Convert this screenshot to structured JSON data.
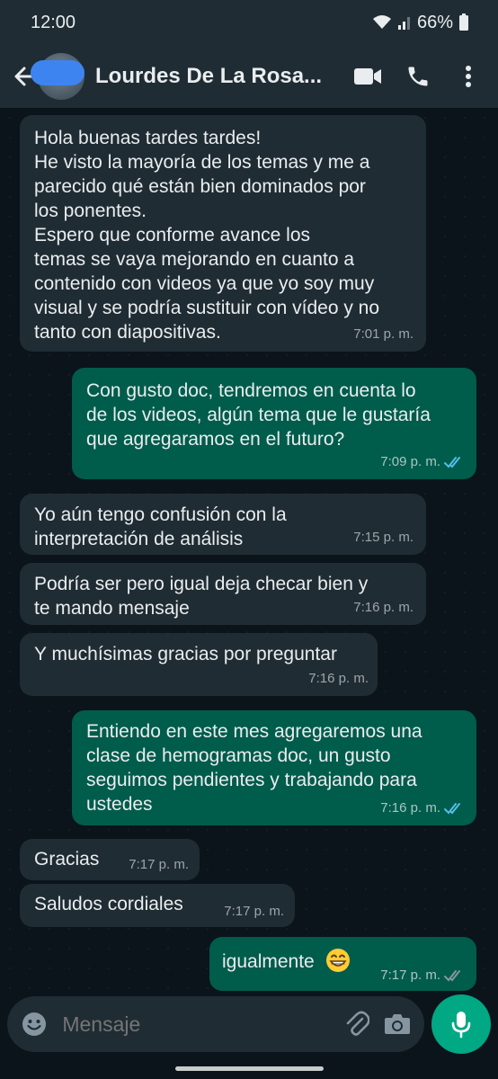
{
  "status_bar": {
    "time": "12:00",
    "battery": "66%"
  },
  "header": {
    "contact_name": "Lourdes De La Rosa..."
  },
  "messages": [
    {
      "direction": "in",
      "lines": [
        "Hola buenas tardes tardes!",
        "He visto la mayoría de los temas y me a",
        "parecido qué están bien dominados por",
        "los ponentes.",
        "Espero que conforme avance los",
        "temas se vaya mejorando en cuanto a",
        "contenido con videos ya que yo soy muy",
        "visual y se podría sustituir con vídeo y no",
        "tanto con diapositivas."
      ],
      "time": "7:01 p. m."
    },
    {
      "direction": "out",
      "lines": [
        "Con gusto doc, tendremos en cuenta lo",
        "de los videos, algún tema que le gustaría",
        "que agregaramos en el futuro?"
      ],
      "time": "7:09 p. m.",
      "read": true
    },
    {
      "direction": "in",
      "lines": [
        "Yo aún tengo confusión con la",
        "interpretación de análisis"
      ],
      "time": "7:15 p. m."
    },
    {
      "direction": "in",
      "lines": [
        "Podría ser pero igual deja checar bien y",
        "te mando mensaje"
      ],
      "time": "7:16 p. m."
    },
    {
      "direction": "in",
      "lines": [
        "Y muchísimas gracias por preguntar"
      ],
      "time": "7:16 p. m."
    },
    {
      "direction": "out",
      "lines": [
        "Entiendo en este mes agregaremos una",
        "clase de hemogramas doc, un gusto",
        "seguimos pendientes y trabajando para",
        "ustedes"
      ],
      "time": "7:16 p. m.",
      "read": true
    },
    {
      "direction": "in",
      "lines": [
        "Gracias"
      ],
      "time": "7:17 p. m."
    },
    {
      "direction": "in",
      "lines": [
        "Saludos cordiales"
      ],
      "time": "7:17 p. m."
    },
    {
      "direction": "out",
      "lines": [
        "igualmente"
      ],
      "emoji": "grinning-face-emoji",
      "time": "7:17 p. m.",
      "read": true
    }
  ],
  "composer": {
    "placeholder": "Mensaje"
  },
  "colors": {
    "incoming_bubble": "#202c33",
    "outgoing_bubble": "#005c4b",
    "read_ticks": "#53bdeb",
    "accent": "#00a884"
  },
  "icons": {
    "back": "arrow-left-icon",
    "video_call": "video-camera-icon",
    "voice_call": "phone-icon",
    "menu": "more-vertical-icon",
    "emoji": "emoji-smiley-icon",
    "attach": "paperclip-icon",
    "camera": "camera-icon",
    "mic": "microphone-icon"
  }
}
